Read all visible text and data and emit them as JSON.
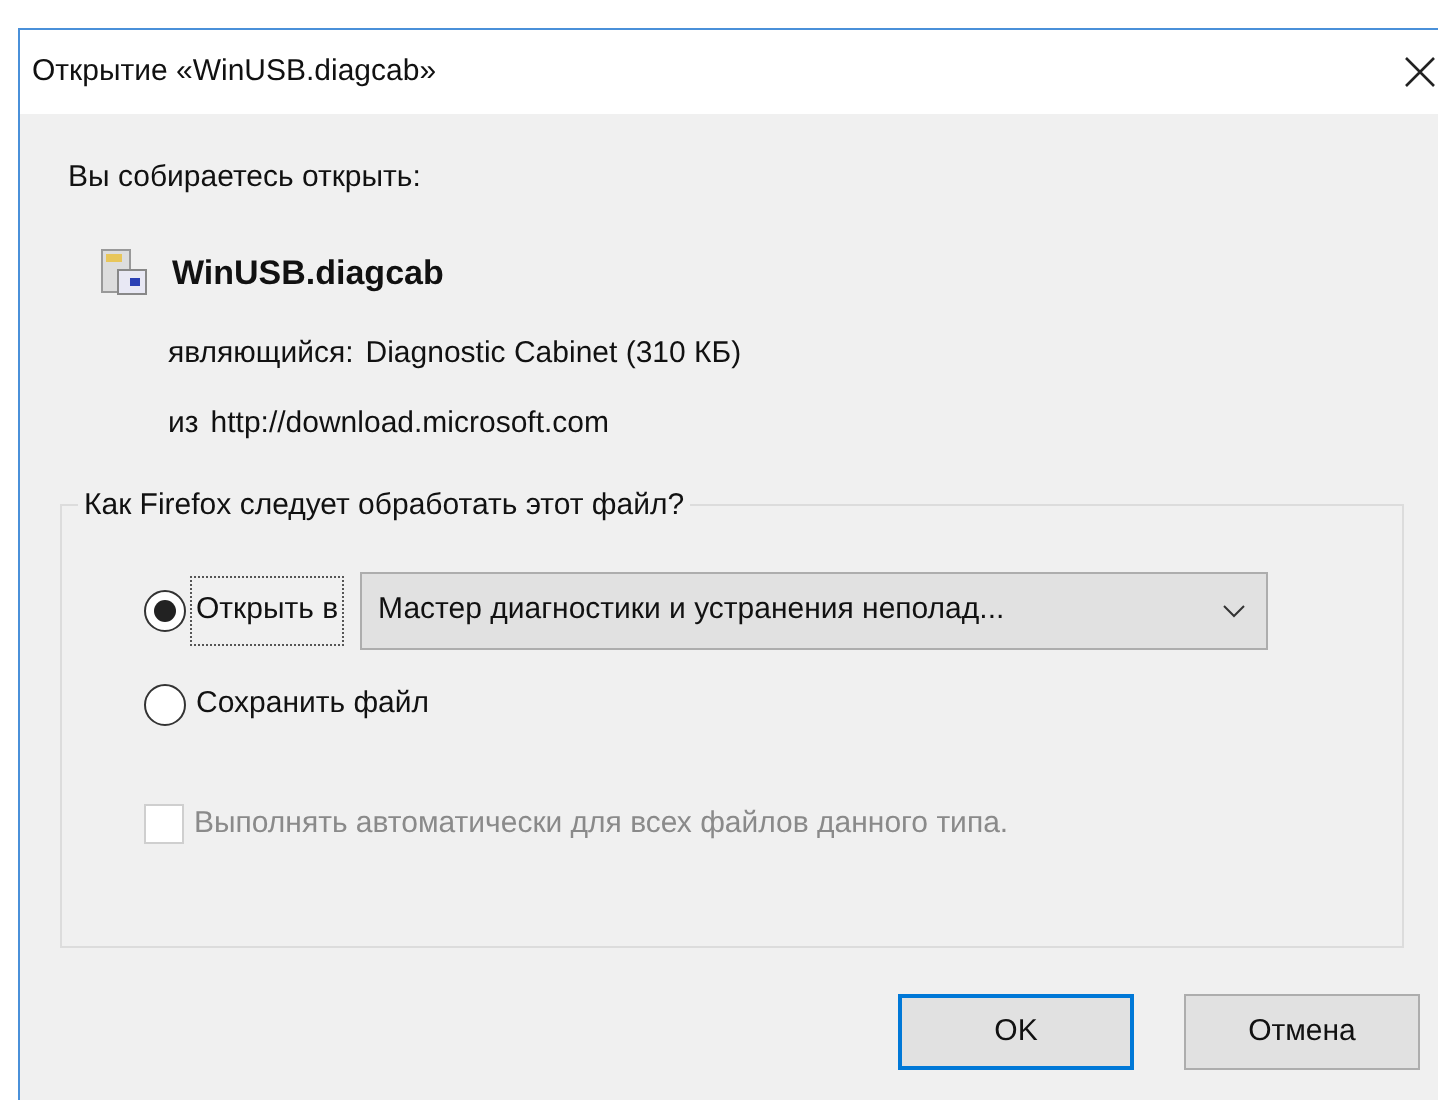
{
  "window": {
    "title": "Открытие «WinUSB.diagcab»"
  },
  "intro": "Вы собираетесь открыть:",
  "file": {
    "name": "WinUSB.diagcab",
    "type_label": "являющийся:",
    "type_value": "Diagnostic Cabinet (310 КБ)",
    "from_label": "из",
    "from_value": "http://download.microsoft.com"
  },
  "group": {
    "legend": "Как Firefox следует обработать этот файл?",
    "options": [
      {
        "kind": "open",
        "label": "Открыть в",
        "selected": true,
        "app": "Мастер диагностики и устранения неполад..."
      },
      {
        "kind": "save",
        "label": "Сохранить файл",
        "selected": false
      }
    ],
    "auto": {
      "label": "Выполнять автоматически для всех файлов данного типа.",
      "checked": false,
      "disabled": true
    }
  },
  "buttons": [
    {
      "label": "OK",
      "default": true
    },
    {
      "label": "Отмена",
      "default": false
    }
  ]
}
